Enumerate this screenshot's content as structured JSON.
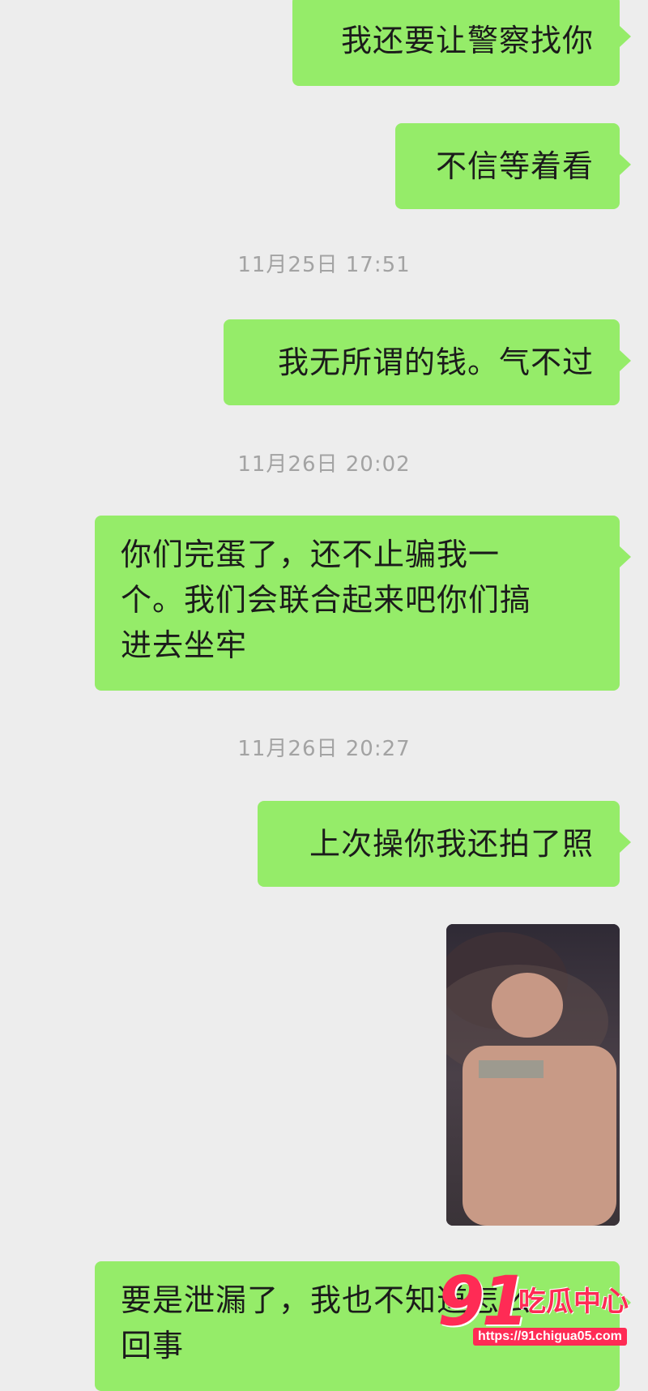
{
  "messages": {
    "m1": "我还要让警察找你",
    "m2": "不信等着看",
    "m3": "我无所谓的钱。气不过",
    "m4": [
      "你们完蛋了，还不止骗我一",
      "个。我们会联合起来吧你们搞",
      "进去坐牢"
    ],
    "m5": "上次操你我还拍了照",
    "m6": [
      "要是泄漏了，我也不知道怎么",
      "回事"
    ]
  },
  "timestamps": {
    "t1": "11月25日 17:51",
    "t2": "11月26日 20:02",
    "t3": "11月26日 20:27"
  },
  "watermark": {
    "logo_number": "91",
    "logo_text": "吃瓜中心",
    "url": "https://91chigua05.com"
  },
  "colors": {
    "bubble": "#95ec69",
    "background": "#ededed",
    "timestamp": "#a3a3a3",
    "watermark": "#ff2b55"
  }
}
